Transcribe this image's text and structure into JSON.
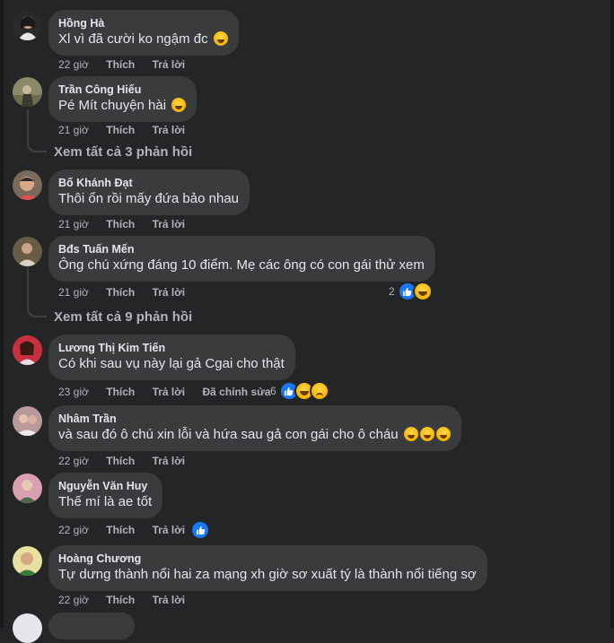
{
  "labels": {
    "like": "Thích",
    "reply": "Trả lời",
    "edited": "Đã chỉnh sửa"
  },
  "comments": [
    {
      "author": "Hồng Hà",
      "text": "Xl vì đã cười ko ngậm đc",
      "time": "22 giờ",
      "emojis": [
        "grin"
      ]
    },
    {
      "author": "Trần Công Hiếu",
      "text": "Pé Mít chuyện hài",
      "time": "21 giờ",
      "emojis": [
        "laugh"
      ]
    },
    {
      "author": "Bố Khánh Đạt",
      "text": "Thôi ổn rồi mấy đứa bảo nhau",
      "time": "21 giờ",
      "emojis": []
    },
    {
      "author": "Bđs Tuấn Mến",
      "text": "Ông chú xứng đáng 10 điểm. Mẹ các ông có con gái thử xem",
      "time": "21 giờ",
      "reaction_count": "2",
      "reactions": [
        "like",
        "haha"
      ]
    },
    {
      "author": "Lương Thị Kim Tiến",
      "text": "Có khi sau vụ này lại gả Cgai cho thật",
      "time": "23 giờ",
      "edited": true,
      "reaction_count": "6",
      "reactions": [
        "like",
        "haha",
        "sad"
      ]
    },
    {
      "author": "Nhâm Trần",
      "text": "và sau đó ô chú xin lỗi và hứa sau gả con gái cho ô cháu",
      "time": "22 giờ",
      "emojis": [
        "rofl",
        "rofl",
        "rofl"
      ]
    },
    {
      "author": "Nguyễn Văn Huy",
      "text": "Thế mí là ae tốt",
      "time": "22 giờ",
      "reactions": [
        "like"
      ]
    },
    {
      "author": "Hoàng Chương",
      "text": "Tự dưng thành nổi hai za mạng xh giờ sơ xuất tý là thành nổi tiếng sợ",
      "time": "22 giờ",
      "emojis": []
    }
  ],
  "view_replies": [
    "Xem tất cả 3 phản hồi",
    "Xem tất cả 9 phản hồi"
  ],
  "colors": {
    "background": "#242526",
    "bubble": "#3a3b3c",
    "text": "#e4e6eb",
    "secondary": "#b0b3b8",
    "like_blue": "#1877f2"
  }
}
